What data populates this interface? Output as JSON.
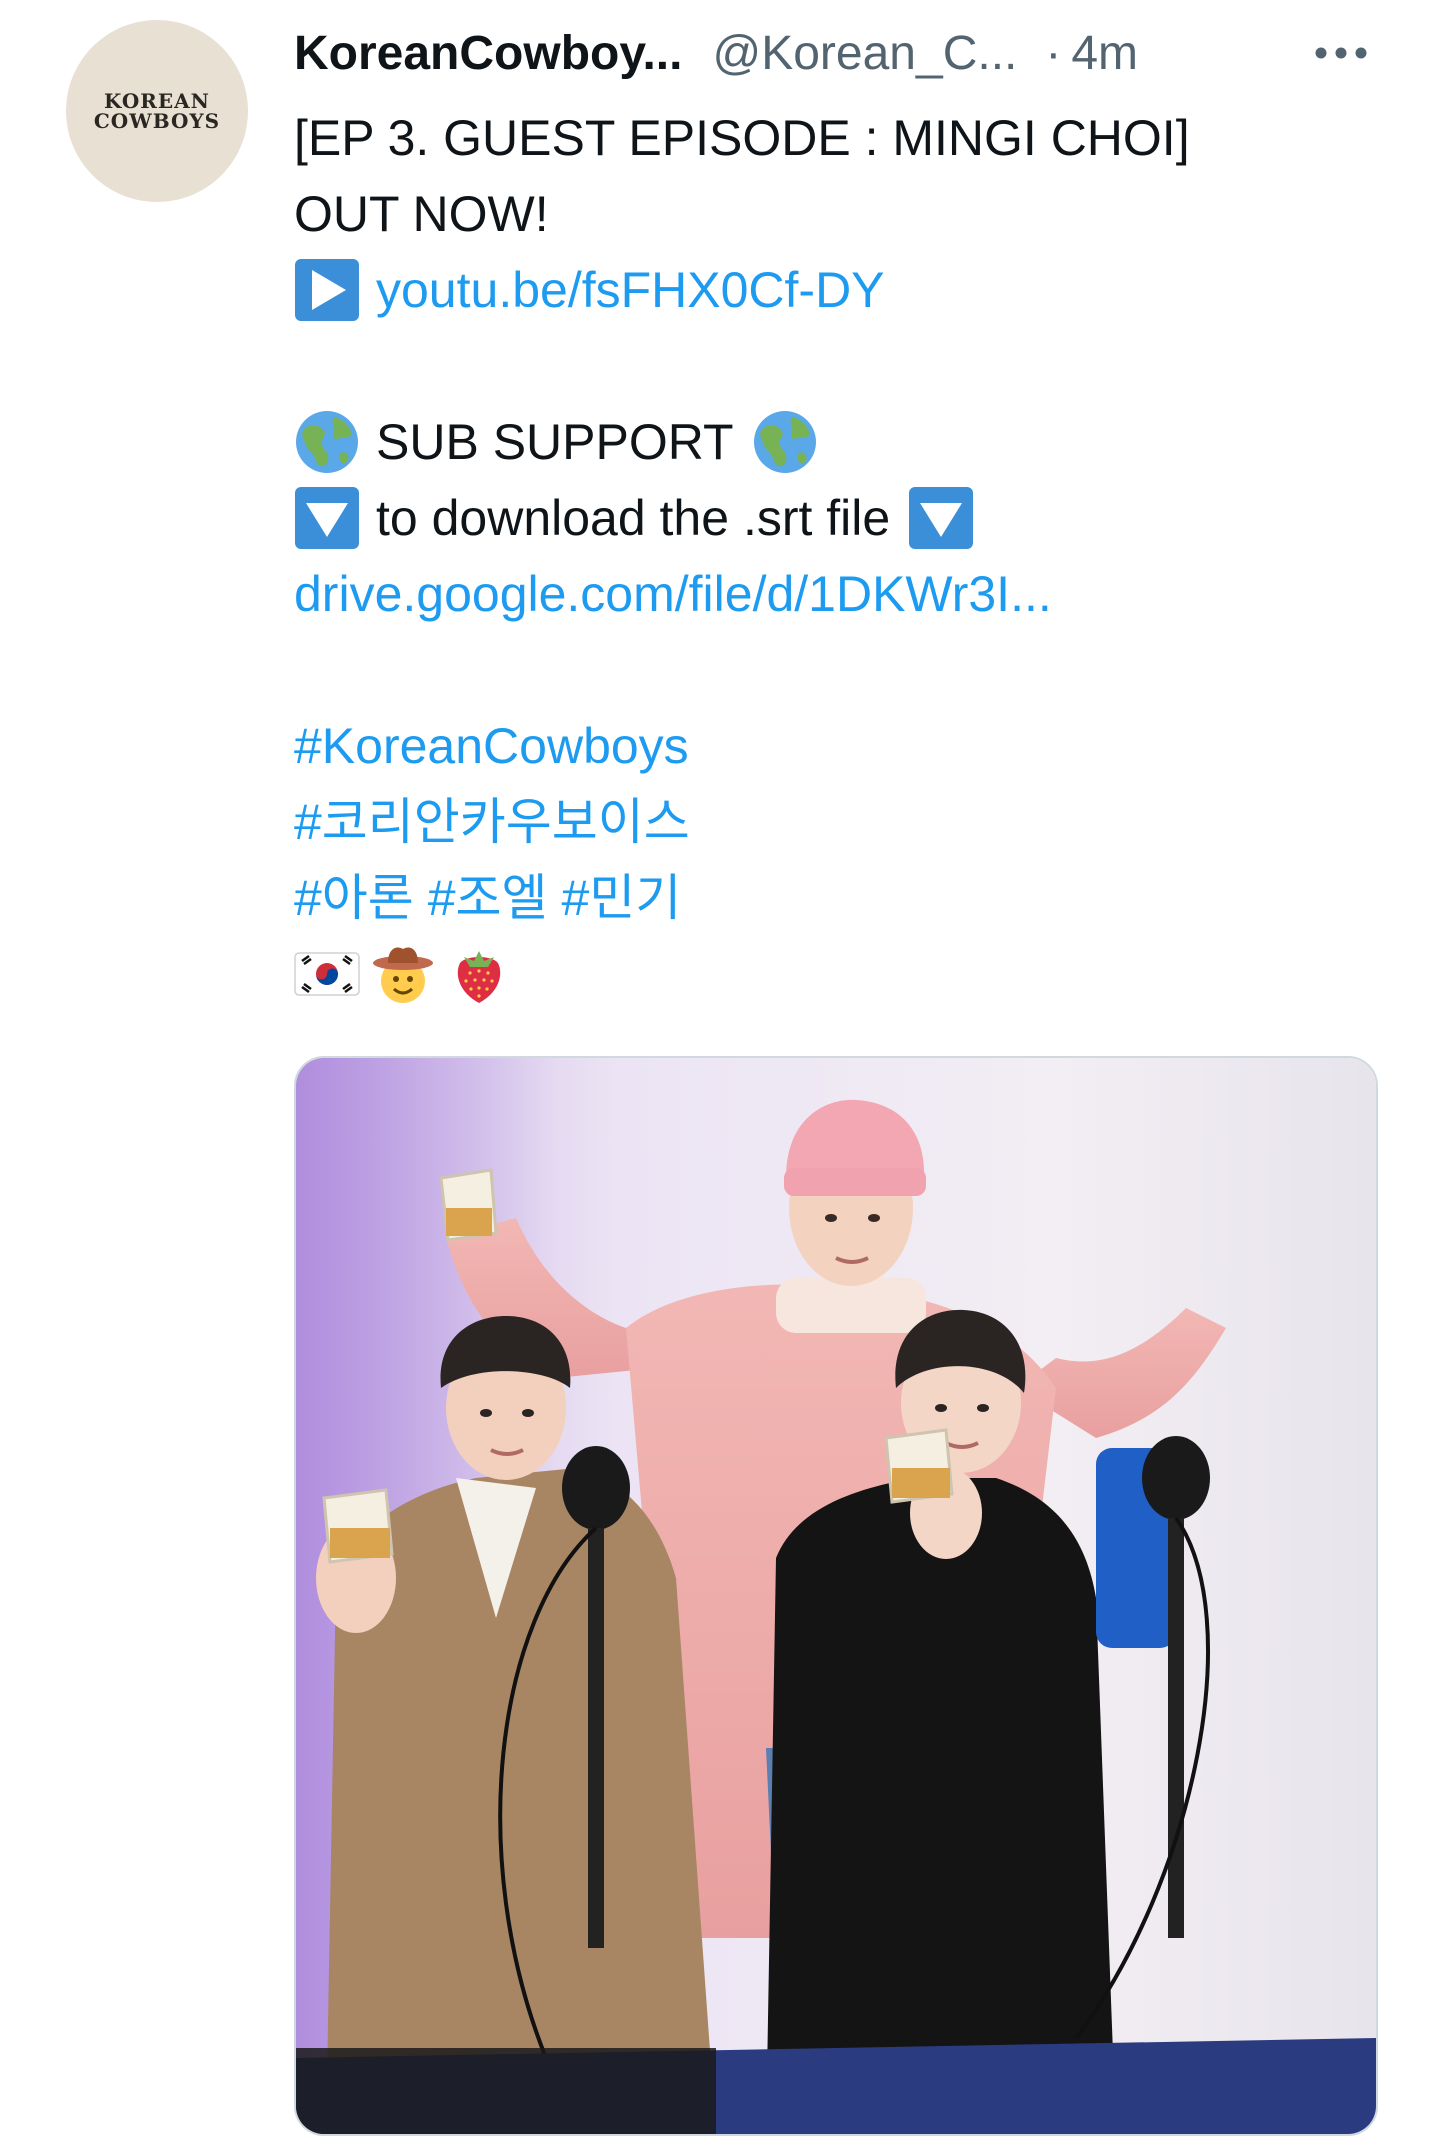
{
  "tweet": {
    "avatar_lines": [
      "KOREAN",
      "COWBOYS"
    ],
    "display_name": "KoreanCowboy...",
    "handle": "@Korean_C...",
    "separator": "·",
    "time": "4m",
    "more_label": "···",
    "lines": {
      "title": "[EP 3. GUEST EPISODE : MINGI CHOI]",
      "out_now": "OUT NOW!",
      "youtube_link": "youtu.be/fsFHX0Cf-DY",
      "sub_support": "SUB SUPPORT",
      "download_text": "to download the .srt file",
      "drive_link": "drive.google.com/file/d/1DKWr3I...",
      "hashtag_1": "#KoreanCowboys",
      "hashtag_2": "#코리안카우보이스",
      "hashtag_3": "#아론",
      "hashtag_4": "#조엘",
      "hashtag_5": "#민기"
    },
    "icons": {
      "play": "play-button-emoji-icon",
      "globe": "globe-americas-emoji-icon",
      "down": "down-arrow-button-emoji-icon",
      "flag": "south-korea-flag-emoji-icon",
      "cowboy": "cowboy-face-emoji-icon",
      "strawberry": "strawberry-emoji-icon"
    },
    "media": {
      "type": "photo"
    },
    "colors": {
      "link": "#1d9bf0",
      "text": "#0f1419",
      "secondary": "#536471",
      "emoji_blue": "#3b8fd9",
      "media_border": "#cfd9de"
    }
  }
}
